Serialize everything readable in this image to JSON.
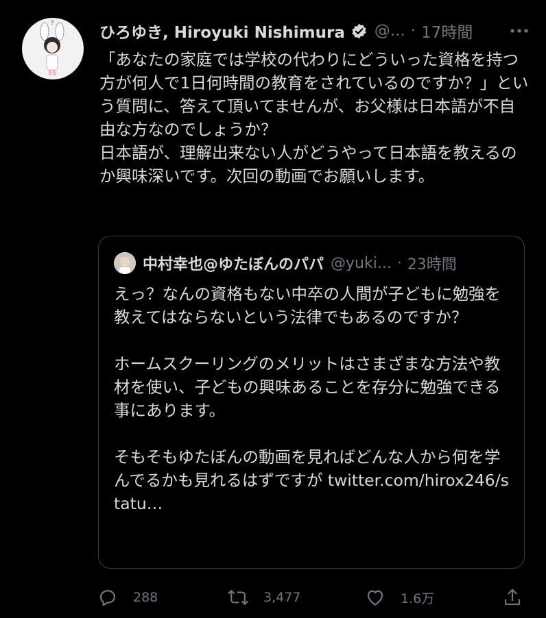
{
  "tweet": {
    "author_name": "ひろゆき, Hiroyuki Nishimura",
    "handle": "@...",
    "separator": "·",
    "time": "17時間",
    "more_label": "•••",
    "text": "「あなたの家庭では学校の代わりにどういった資格を持つ方が何人で1日何時間の教育をされているのですか？」という質問に、答えて頂いてませんが、お父様は日本語が不自由な方なのでしょうか？\n日本語が、理解出来ない人がどうやって日本語を教えるのか興味深いです。次回の動画でお願いします。",
    "quoted": {
      "author_name": "中村幸也@ゆたぼんのパパ",
      "handle": "@yuki...",
      "separator": "·",
      "time": "23時間",
      "text": "えっ？なんの資格もない中卒の人間が子どもに勉強を教えてはならないという法律でもあるのですか？\n\nホームスクーリングのメリットはさまざまな方法や教材を使い、子どもの興味あることを存分に勉強できる事にあります。\n\nそもそもゆたぼんの動画を見ればどんな人から何を学んでるかも見れるはずですが twitter.com/hirox246/statu…"
    },
    "actions": {
      "reply_count": "288",
      "retweet_count": "3,477",
      "like_count": "1.6万"
    }
  },
  "icons": {
    "verified": "verified-badge-icon",
    "more": "more-horizontal-icon",
    "reply": "reply-icon",
    "retweet": "retweet-icon",
    "like": "heart-icon",
    "share": "share-icon"
  },
  "colors": {
    "background": "#000000",
    "text": "#d9d9d9",
    "secondary": "#6e767d",
    "border": "#3a3d40"
  }
}
